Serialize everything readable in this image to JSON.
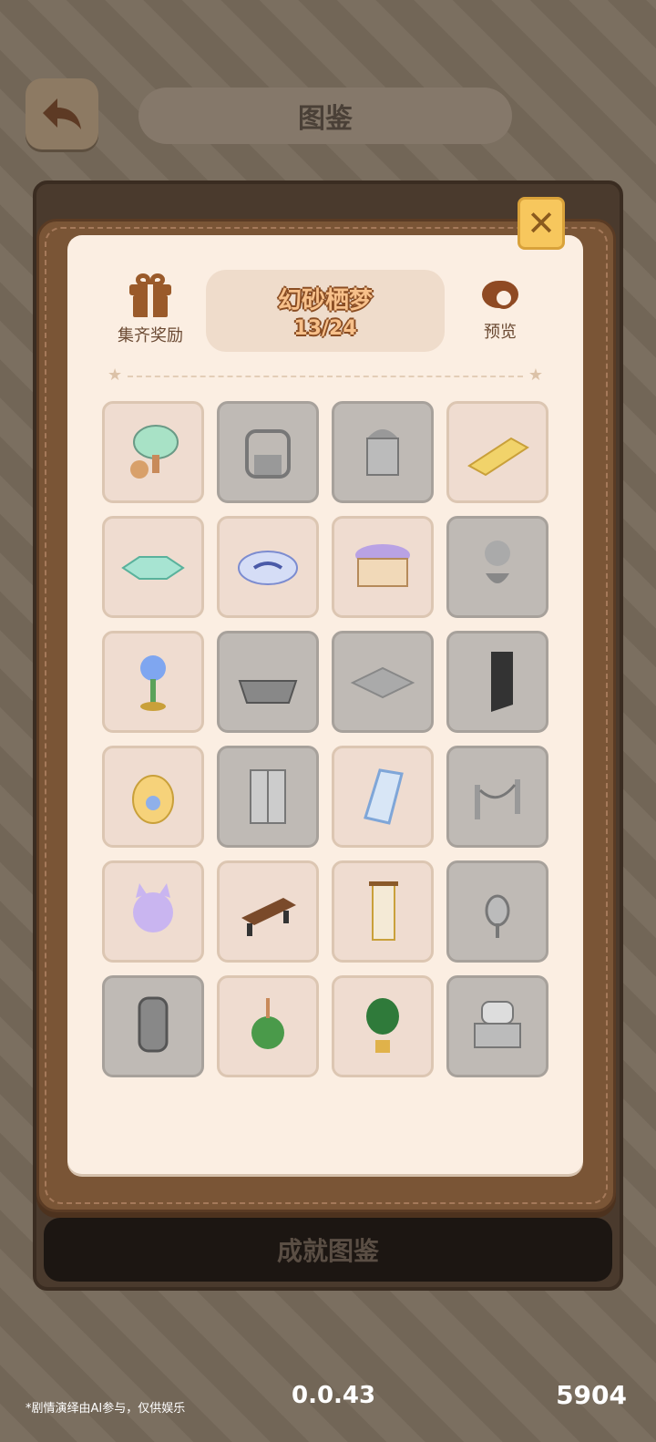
{
  "background": {
    "title": "图鉴",
    "bottom_button": "成就图鉴"
  },
  "footer": {
    "note": "*剧情演绎由AI参与，仅供娱乐",
    "version": "0.0.43",
    "number": "5904"
  },
  "modal": {
    "reward_label": "集齐奖励",
    "set_name": "幻砂栖梦",
    "progress": "13/24",
    "preview_label": "预览",
    "close_icon": "close-icon"
  },
  "colors": {
    "owned_tile": "#efdcd0",
    "locked_tile": "#bfbab5",
    "accent": "#f7c75d"
  },
  "items": [
    {
      "id": "wall-lamp",
      "owned": true
    },
    {
      "id": "ornate-bed-frame",
      "owned": false
    },
    {
      "id": "canopy-pavilion",
      "owned": false
    },
    {
      "id": "tasseled-rug",
      "owned": true
    },
    {
      "id": "teal-floor-rug",
      "owned": true
    },
    {
      "id": "blue-oval-rug",
      "owned": true
    },
    {
      "id": "purple-ottoman",
      "owned": true
    },
    {
      "id": "flower-vase",
      "owned": false
    },
    {
      "id": "blue-flower-lamp",
      "owned": true
    },
    {
      "id": "bathtub",
      "owned": false
    },
    {
      "id": "floor-tile",
      "owned": false
    },
    {
      "id": "wall-panel",
      "owned": false
    },
    {
      "id": "hanging-egg-chair",
      "owned": true
    },
    {
      "id": "wardrobe",
      "owned": false
    },
    {
      "id": "floral-mirror",
      "owned": true
    },
    {
      "id": "rope-barrier",
      "owned": false
    },
    {
      "id": "cat-plush",
      "owned": true
    },
    {
      "id": "guqin-table",
      "owned": true
    },
    {
      "id": "hanging-scroll",
      "owned": true
    },
    {
      "id": "hand-mirror",
      "owned": false
    },
    {
      "id": "vanity-mirror",
      "owned": false
    },
    {
      "id": "hanging-plant",
      "owned": true
    },
    {
      "id": "potted-plant",
      "owned": true
    },
    {
      "id": "dresser-table",
      "owned": false
    }
  ]
}
